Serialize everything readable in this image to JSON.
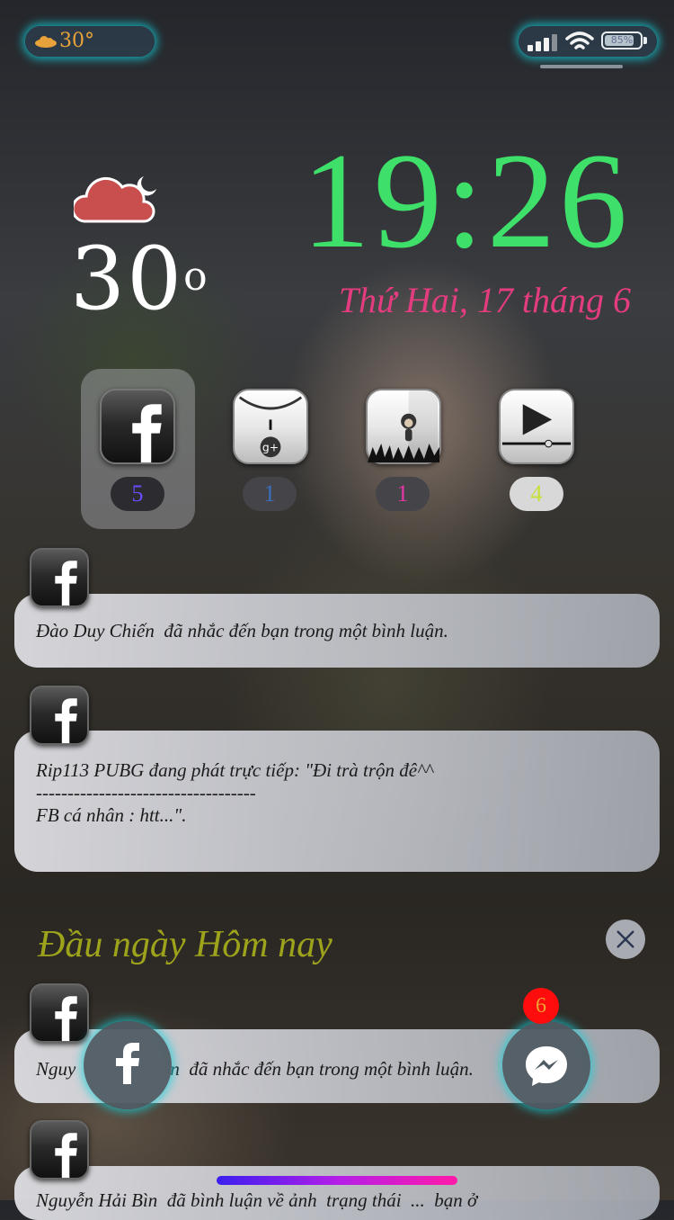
{
  "status_bar": {
    "weather_temp": "30°",
    "battery_text": "85%",
    "battery_level": 0.85
  },
  "weather": {
    "temperature": "30",
    "degree": "o",
    "icon": "cloud-moon-icon"
  },
  "clock": {
    "time": "19:26",
    "date": "Thứ Hai, 17 tháng 6"
  },
  "apps": [
    {
      "name": "facebook",
      "icon": "facebook-icon",
      "badge": "5",
      "badge_bg": "#2b2b30",
      "badge_color": "#6a4cff"
    },
    {
      "name": "google-plus",
      "icon": "google-plus-icon",
      "badge": "1",
      "badge_bg": "#444449",
      "badge_color": "#3a6fbf"
    },
    {
      "name": "monkey-game",
      "icon": "monkey-icon",
      "badge": "1",
      "badge_bg": "#444449",
      "badge_color": "#e838a6"
    },
    {
      "name": "video-player",
      "icon": "play-icon",
      "badge": "4",
      "badge_bg": "#d8d8d8",
      "badge_color": "#c9e03a"
    }
  ],
  "notifications": [
    {
      "lines": [
        "Đào Duy Chiến  đã nhắc đến bạn trong một bình luận."
      ]
    },
    {
      "lines": [
        "Rip113 PUBG đang phát trực tiếp: \"Đi trà trộn đê^^",
        "-----------------------------------",
        "FB cá nhân : htt...\"."
      ]
    }
  ],
  "section": {
    "title": "Đầu ngày Hôm nay"
  },
  "earlier_notifications": [
    {
      "lines": [
        "Nguy                    n  đã nhắc đến bạn trong một bình luận."
      ]
    },
    {
      "lines": [
        "Nguyễn Hải Bìn  đã bình luận về ảnh  trạng thái  ...  bạn ở"
      ]
    }
  ],
  "messenger_badge": "6",
  "colors": {
    "clock": "#3ee06a",
    "date": "#e33c7f",
    "section_title": "#9ea31c",
    "glow": "#14d2dc"
  }
}
